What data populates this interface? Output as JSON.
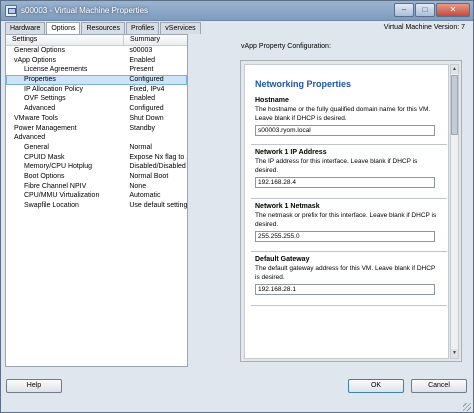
{
  "window": {
    "title": "s00003 - Virtual Machine Properties",
    "minimize": "–",
    "maximize": "□",
    "close": "✕",
    "version": "Virtual Machine Version: 7"
  },
  "tabs": [
    "Hardware",
    "Options",
    "Resources",
    "Profiles",
    "vServices"
  ],
  "tree": {
    "header": {
      "settings": "Settings",
      "summary": "Summary"
    },
    "rows": [
      {
        "name": "General Options",
        "value": "s00003",
        "level": 0
      },
      {
        "name": "vApp Options",
        "value": "Enabled",
        "level": 0
      },
      {
        "name": "License Agreements",
        "value": "Present",
        "level": 1
      },
      {
        "name": "Properties",
        "value": "Configured",
        "level": 1,
        "selected": true
      },
      {
        "name": "IP Allocation Policy",
        "value": "Fixed, IPv4",
        "level": 1
      },
      {
        "name": "OVF Settings",
        "value": "Enabled",
        "level": 1
      },
      {
        "name": "Advanced",
        "value": "Configured",
        "level": 1
      },
      {
        "name": "VMware Tools",
        "value": "Shut Down",
        "level": 0
      },
      {
        "name": "Power Management",
        "value": "Standby",
        "level": 0
      },
      {
        "name": "Advanced",
        "value": "",
        "level": 0
      },
      {
        "name": "General",
        "value": "Normal",
        "level": 1
      },
      {
        "name": "CPUID Mask",
        "value": "Expose Nx flag to ...",
        "level": 1
      },
      {
        "name": "Memory/CPU Hotplug",
        "value": "Disabled/Disabled",
        "level": 1
      },
      {
        "name": "Boot Options",
        "value": "Normal Boot",
        "level": 1
      },
      {
        "name": "Fibre Channel NPIV",
        "value": "None",
        "level": 1
      },
      {
        "name": "CPU/MMU Virtualization",
        "value": "Automatic",
        "level": 1
      },
      {
        "name": "Swapfile Location",
        "value": "Use default settings",
        "level": 1
      }
    ]
  },
  "vapp": {
    "label": "vApp Property Configuration:",
    "section_title": "Networking Properties",
    "fields": [
      {
        "name": "Hostname",
        "desc": "The hostname or the fully qualified domain name for this VM. Leave blank if DHCP is desired.",
        "value": "s00003.ryom.local"
      },
      {
        "name": "Network 1 IP Address",
        "desc": "The IP address for this interface. Leave blank if DHCP is desired.",
        "value": "192.168.28.4"
      },
      {
        "name": "Network 1 Netmask",
        "desc": "The netmask or prefix for this interface. Leave blank if DHCP is desired.",
        "value": "255.255.255.0"
      },
      {
        "name": "Default Gateway",
        "desc": "The default gateway address for this VM. Leave blank if DHCP is desired.",
        "value": "192.168.28.1"
      }
    ],
    "scroll_up": "▲",
    "scroll_down": "▼"
  },
  "buttons": {
    "help": "Help",
    "ok": "OK",
    "cancel": "Cancel"
  }
}
